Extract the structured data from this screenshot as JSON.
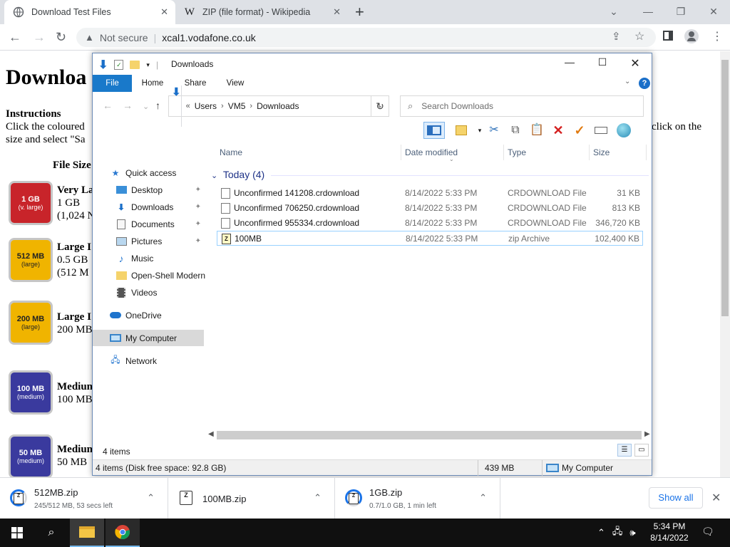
{
  "browser": {
    "tabs": [
      {
        "title": "Download Test Files",
        "active": true,
        "icon": "globe-icon"
      },
      {
        "title": "ZIP (file format) - Wikipedia",
        "active": false,
        "icon": "wikipedia-icon",
        "favicon_letter": "W"
      }
    ],
    "address": {
      "security": "Not secure",
      "url": "xcal1.vodafone.co.uk"
    }
  },
  "webpage": {
    "heading": "Downloa",
    "instructions_heading": "Instructions",
    "instructions_line1": "Click the coloured",
    "instructions_line2": "size and select \"Sa",
    "instructions_right": "click on the",
    "col_file_size": "File Size",
    "files": [
      {
        "tile_size": "1 GB",
        "tile_tag": "(v. large)",
        "title": "Very La",
        "size": "1 GB",
        "detail": "(1,024 N",
        "color": "red"
      },
      {
        "tile_size": "512 MB",
        "tile_tag": "(large)",
        "title": "Large I",
        "size": "0.5 GB",
        "detail": "(512 M",
        "color": "yellow"
      },
      {
        "tile_size": "200 MB",
        "tile_tag": "(large)",
        "title": "Large I",
        "size": "200 MB",
        "detail": "",
        "color": "yellow"
      },
      {
        "tile_size": "100 MB",
        "tile_tag": "(medium)",
        "title": "Mediun",
        "size": "100 MB",
        "detail": "",
        "color": "blue"
      },
      {
        "tile_size": "50 MB",
        "tile_tag": "(medium)",
        "title": "Mediun",
        "size": "50 MB",
        "detail": "",
        "color": "blue"
      }
    ]
  },
  "explorer": {
    "title": "Downloads",
    "ribbon_tabs": [
      "File",
      "Home",
      "Share",
      "View"
    ],
    "breadcrumb": [
      "Users",
      "VM5",
      "Downloads"
    ],
    "search_placeholder": "Search Downloads",
    "nav": [
      {
        "label": "Quick access",
        "icon": "star-icon",
        "pinned": false,
        "indent": false
      },
      {
        "label": "Desktop",
        "icon": "desktop-icon",
        "pinned": true,
        "indent": true
      },
      {
        "label": "Downloads",
        "icon": "download-icon",
        "pinned": true,
        "indent": true
      },
      {
        "label": "Documents",
        "icon": "document-icon",
        "pinned": true,
        "indent": true
      },
      {
        "label": "Pictures",
        "icon": "picture-icon",
        "pinned": true,
        "indent": true
      },
      {
        "label": "Music",
        "icon": "music-icon",
        "pinned": false,
        "indent": true
      },
      {
        "label": "Open-Shell Modern",
        "icon": "folder-icon",
        "pinned": false,
        "indent": true
      },
      {
        "label": "Videos",
        "icon": "video-icon",
        "pinned": false,
        "indent": true
      },
      {
        "label": "OneDrive",
        "icon": "cloud-icon",
        "pinned": false,
        "indent": false
      },
      {
        "label": "My Computer",
        "icon": "computer-icon",
        "pinned": false,
        "indent": false,
        "selected": true
      },
      {
        "label": "Network",
        "icon": "network-icon",
        "pinned": false,
        "indent": false
      }
    ],
    "columns": [
      "Name",
      "Date modified",
      "Type",
      "Size"
    ],
    "group": "Today (4)",
    "files": [
      {
        "name": "Unconfirmed 141208.crdownload",
        "date": "8/14/2022 5:33 PM",
        "type": "CRDOWNLOAD File",
        "size": "31 KB",
        "icon": "file-icon"
      },
      {
        "name": "Unconfirmed 706250.crdownload",
        "date": "8/14/2022 5:33 PM",
        "type": "CRDOWNLOAD File",
        "size": "813 KB",
        "icon": "file-icon"
      },
      {
        "name": "Unconfirmed 955334.crdownload",
        "date": "8/14/2022 5:33 PM",
        "type": "CRDOWNLOAD File",
        "size": "346,720 KB",
        "icon": "file-icon"
      },
      {
        "name": "100MB",
        "date": "8/14/2022 5:33 PM",
        "type": "zip Archive",
        "size": "102,400 KB",
        "icon": "zip-file-icon",
        "selected": true
      }
    ],
    "items_count": "4 items",
    "status_free": "4 items (Disk free space: 92.8 GB)",
    "status_size": "439 MB",
    "status_location": "My Computer"
  },
  "downloads": [
    {
      "name": "512MB.zip",
      "status": "245/512 MB, 53 secs left",
      "progress": 0.48
    },
    {
      "name": "100MB.zip",
      "status": "",
      "progress": 1.0
    },
    {
      "name": "1GB.zip",
      "status": "0.7/1.0 GB, 1 min left",
      "progress": 0.7
    }
  ],
  "shelf": {
    "show_all": "Show all"
  },
  "taskbar": {
    "time": "5:34 PM",
    "date": "8/14/2022"
  }
}
